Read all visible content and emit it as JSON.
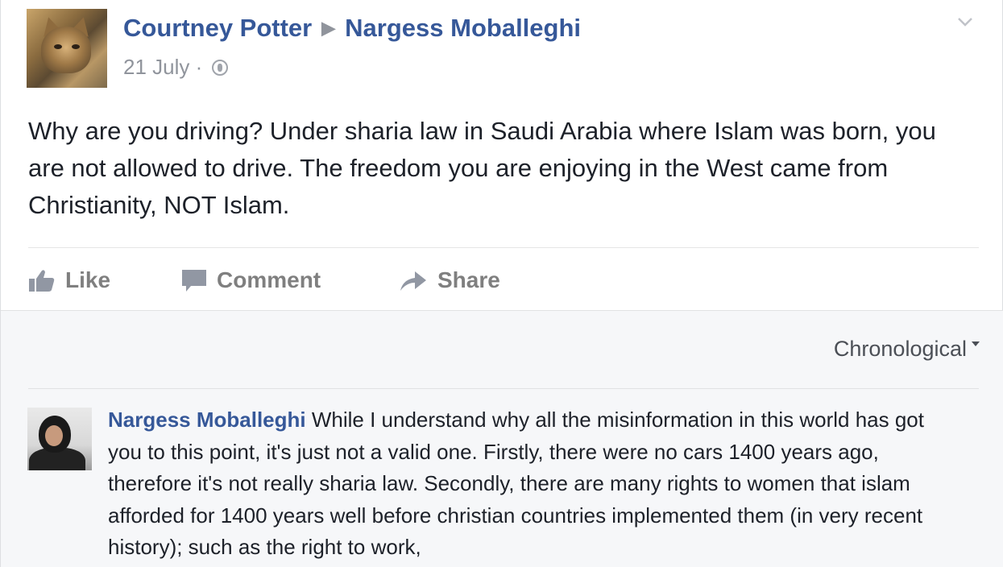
{
  "post": {
    "author": "Courtney Potter",
    "recipient": "Nargess Moballeghi",
    "date": "21 July",
    "separator": "·",
    "privacy_icon": "globe-icon",
    "text": "Why are you driving? Under sharia law in Saudi Arabia where Islam was born, you are not allowed to drive. The freedom you are enjoying in the West came from Christianity, NOT Islam."
  },
  "actions": {
    "like_label": "Like",
    "comment_label": "Comment",
    "share_label": "Share"
  },
  "comments": {
    "sort_label": "Chronological",
    "items": [
      {
        "author": "Nargess Moballeghi",
        "text": "While I understand why all the misinformation in this world has got you to this point, it's just not a valid one. Firstly, there were no cars 1400 years ago, therefore it's not really sharia law. Secondly, there are many rights to women that islam afforded for 1400 years well before christian countries implemented them (in very recent history); such as the right to work,"
      }
    ]
  },
  "colors": {
    "link": "#365899",
    "text": "#1d2129",
    "muted": "#90949c",
    "comments_bg": "#f6f7f9"
  }
}
